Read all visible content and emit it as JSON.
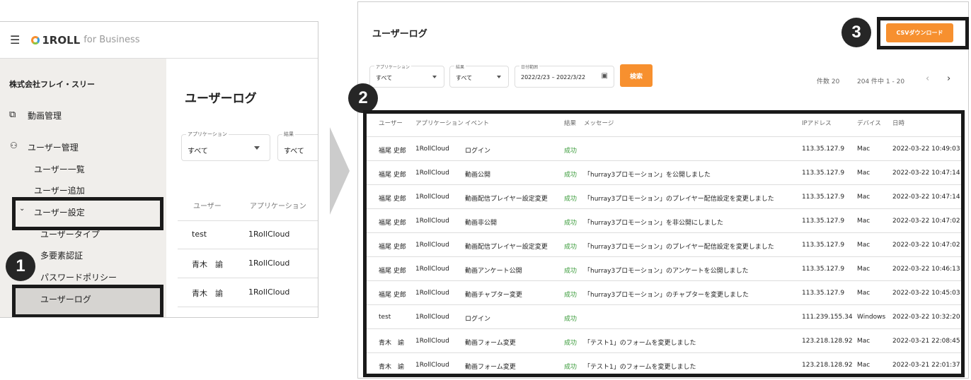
{
  "left": {
    "brand": "1ROLL",
    "brand_suffix": "for Business",
    "company": "株式会社フレイ・スリー",
    "nav": {
      "video": "動画管理",
      "user_mgmt": "ユーザー管理",
      "user_list": "ユーザー一覧",
      "user_add": "ユーザー追加",
      "user_settings": "ユーザー設定",
      "user_type": "ユーザータイプ",
      "mfa": "多要素認証",
      "password_policy": "パスワードポリシー",
      "user_log": "ユーザーログ"
    },
    "title": "ユーザーログ",
    "filter_app_label": "アプリケーション",
    "filter_app_value": "すべて",
    "filter_result_label": "結果",
    "filter_result_value": "すべて",
    "columns": [
      "ユーザー",
      "アプリケーション"
    ],
    "rows": [
      [
        "test",
        "1RollCloud"
      ],
      [
        "青木　諭",
        "1RollCloud"
      ],
      [
        "青木　諭",
        "1RollCloud"
      ]
    ]
  },
  "badges": [
    "1",
    "2",
    "3"
  ],
  "right": {
    "title": "ユーザーログ",
    "csv_button": "CSVダウンロード",
    "filters": {
      "app_label": "アプリケーション",
      "app_value": "すべて",
      "result_label": "結果",
      "result_value": "すべて",
      "date_label": "日付範囲",
      "date_value": "2022/2/23 – 2022/3/22",
      "search": "検索"
    },
    "count": "件数 20",
    "range": "204 件中 1 - 20",
    "columns": [
      "ユーザー",
      "アプリケーション",
      "イベント",
      "結果",
      "メッセージ",
      "IPアドレス",
      "デバイス",
      "日時"
    ],
    "rows": [
      [
        "福尾 史郎",
        "1RollCloud",
        "ログイン",
        "成功",
        "",
        "113.35.127.9",
        "Mac",
        "2022-03-22 10:49:03"
      ],
      [
        "福尾 史郎",
        "1RollCloud",
        "動画公開",
        "成功",
        "「hurray3プロモーション」を公開しました",
        "113.35.127.9",
        "Mac",
        "2022-03-22 10:47:14"
      ],
      [
        "福尾 史郎",
        "1RollCloud",
        "動画配信プレイヤー設定変更",
        "成功",
        "「hurray3プロモーション」のプレイヤー配信設定を変更しました",
        "113.35.127.9",
        "Mac",
        "2022-03-22 10:47:14"
      ],
      [
        "福尾 史郎",
        "1RollCloud",
        "動画非公開",
        "成功",
        "「hurray3プロモーション」を非公開にしました",
        "113.35.127.9",
        "Mac",
        "2022-03-22 10:47:02"
      ],
      [
        "福尾 史郎",
        "1RollCloud",
        "動画配信プレイヤー設定変更",
        "成功",
        "「hurray3プロモーション」のプレイヤー配信設定を変更しました",
        "113.35.127.9",
        "Mac",
        "2022-03-22 10:47:02"
      ],
      [
        "福尾 史郎",
        "1RollCloud",
        "動画アンケート公開",
        "成功",
        "「hurray3プロモーション」のアンケートを公開しました",
        "113.35.127.9",
        "Mac",
        "2022-03-22 10:46:13"
      ],
      [
        "福尾 史郎",
        "1RollCloud",
        "動画チャプター変更",
        "成功",
        "「hurray3プロモーション」のチャプターを変更しました",
        "113.35.127.9",
        "Mac",
        "2022-03-22 10:45:03"
      ],
      [
        "test",
        "1RollCloud",
        "ログイン",
        "成功",
        "",
        "111.239.155.34",
        "Windows",
        "2022-03-22 10:32:20"
      ],
      [
        "青木　諭",
        "1RollCloud",
        "動画フォーム変更",
        "成功",
        "「テスト1」のフォームを変更しました",
        "123.218.128.92",
        "Mac",
        "2022-03-21 22:08:45"
      ],
      [
        "青木　諭",
        "1RollCloud",
        "動画フォーム変更",
        "成功",
        "「テスト1」のフォームを変更しました",
        "123.218.128.92",
        "Mac",
        "2022-03-21 22:01:37"
      ]
    ]
  },
  "colors": {
    "accent": "#f7902f",
    "success": "#3a9b3a"
  }
}
